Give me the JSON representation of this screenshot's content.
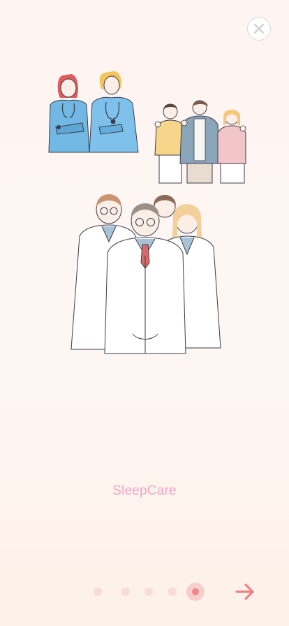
{
  "app": {
    "brand_name": "SleepCare"
  },
  "onboarding": {
    "total_pages": 5,
    "current_page": 5
  },
  "icons": {
    "close": "close-icon",
    "next": "arrow-right-icon"
  },
  "colors": {
    "brand_text": "#f2a4c8",
    "active_dot": "#ee8686",
    "inactive_dot": "#f7dcda",
    "arrow": "#ef7f84"
  }
}
